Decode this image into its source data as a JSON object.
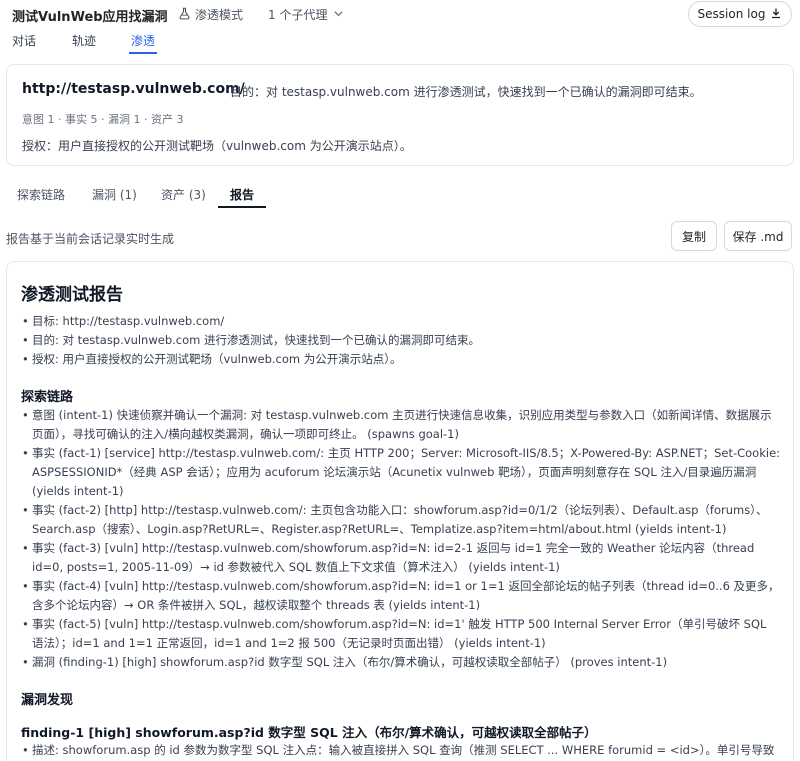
{
  "header": {
    "app_title": "测试VulnWeb应用找漏洞",
    "mode_label": "渗透模式",
    "agent_select": "1 个子代理",
    "session_log": "Session log"
  },
  "main_tabs": [
    "对话",
    "轨迹",
    "渗透"
  ],
  "target": {
    "url": "http://testasp.vulnweb.com/",
    "goal": "目的：对 testasp.vulnweb.com 进行渗透测试，快速找到一个已确认的漏洞即可结束。",
    "stats": "意图 1 · 事实 5 · 漏洞 1 · 资产 3",
    "auth": "授权：用户直接授权的公开测试靶场（vulnweb.com 为公开演示站点）。"
  },
  "sub_tabs": [
    "探索链路",
    "漏洞 (1)",
    "资产 (3)",
    "报告"
  ],
  "report_note": "报告基于当前会话记录实时生成",
  "buttons": {
    "copy": "复制",
    "save": "保存 .md"
  },
  "report": {
    "title": "渗透测试报告",
    "summary": [
      "目标: http://testasp.vulnweb.com/",
      "目的: 对 testasp.vulnweb.com 进行渗透测试，快速找到一个已确认的漏洞即可结束。",
      "授权: 用户直接授权的公开测试靶场（vulnweb.com 为公开演示站点）。"
    ],
    "chain_heading": "探索链路",
    "chain": [
      "意图 (intent-1) 快速侦察并确认一个漏洞: 对 testasp.vulnweb.com 主页进行快速信息收集，识别应用类型与参数入口（如新闻详情、数据展示页面），寻找可确认的注入/横向越权类漏洞，确认一项即可终止。 (spawns goal-1)",
      "事实 (fact-1) [service] http://testasp.vulnweb.com/: 主页 HTTP 200；Server: Microsoft-IIS/8.5；X-Powered-By: ASP.NET；Set-Cookie: ASPSESSIONID*（经典 ASP 会话）；应用为 acuforum 论坛演示站（Acunetix vulnweb 靶场），页面声明刻意存在 SQL 注入/目录遍历漏洞 (yields intent-1)",
      "事实 (fact-2) [http] http://testasp.vulnweb.com/: 主页包含功能入口：showforum.asp?id=0/1/2（论坛列表）、Default.asp（forums）、Search.asp（搜索）、Login.asp?RetURL=、Register.asp?RetURL=、Templatize.asp?item=html/about.html (yields intent-1)",
      "事实 (fact-3) [vuln] http://testasp.vulnweb.com/showforum.asp?id=N: id=2-1 返回与 id=1 完全一致的 Weather 论坛内容（thread id=0, posts=1, 2005-11-09）→ id 参数被代入 SQL 数值上下文求值（算术注入） (yields intent-1)",
      "事实 (fact-4) [vuln] http://testasp.vulnweb.com/showforum.asp?id=N: id=1 or 1=1 返回全部论坛的帖子列表（thread id=0..6 及更多，含多个论坛内容）→ OR 条件被拼入 SQL，越权读取整个 threads 表 (yields intent-1)",
      "事实 (fact-5) [vuln] http://testasp.vulnweb.com/showforum.asp?id=N: id=1' 触发 HTTP 500 Internal Server Error（单引号破坏 SQL 语法）；id=1 and 1=1 正常返回，id=1 and 1=2 报 500（无记录时页面出错） (yields intent-1)",
      "漏洞 (finding-1) [high] showforum.asp?id 数字型 SQL 注入（布尔/算术确认，可越权读取全部帖子） (proves intent-1)"
    ],
    "findings_heading": "漏洞发现",
    "finding_title": "finding-1 [high] showforum.asp?id 数字型 SQL 注入（布尔/算术确认，可越权读取全部帖子）",
    "finding_items": [
      "描述: showforum.asp 的 id 参数为数字型 SQL 注入点：输入被直接拼入 SQL 查询（推测 SELECT ... WHERE forumid = <id>）。单引号导致"
    ]
  }
}
